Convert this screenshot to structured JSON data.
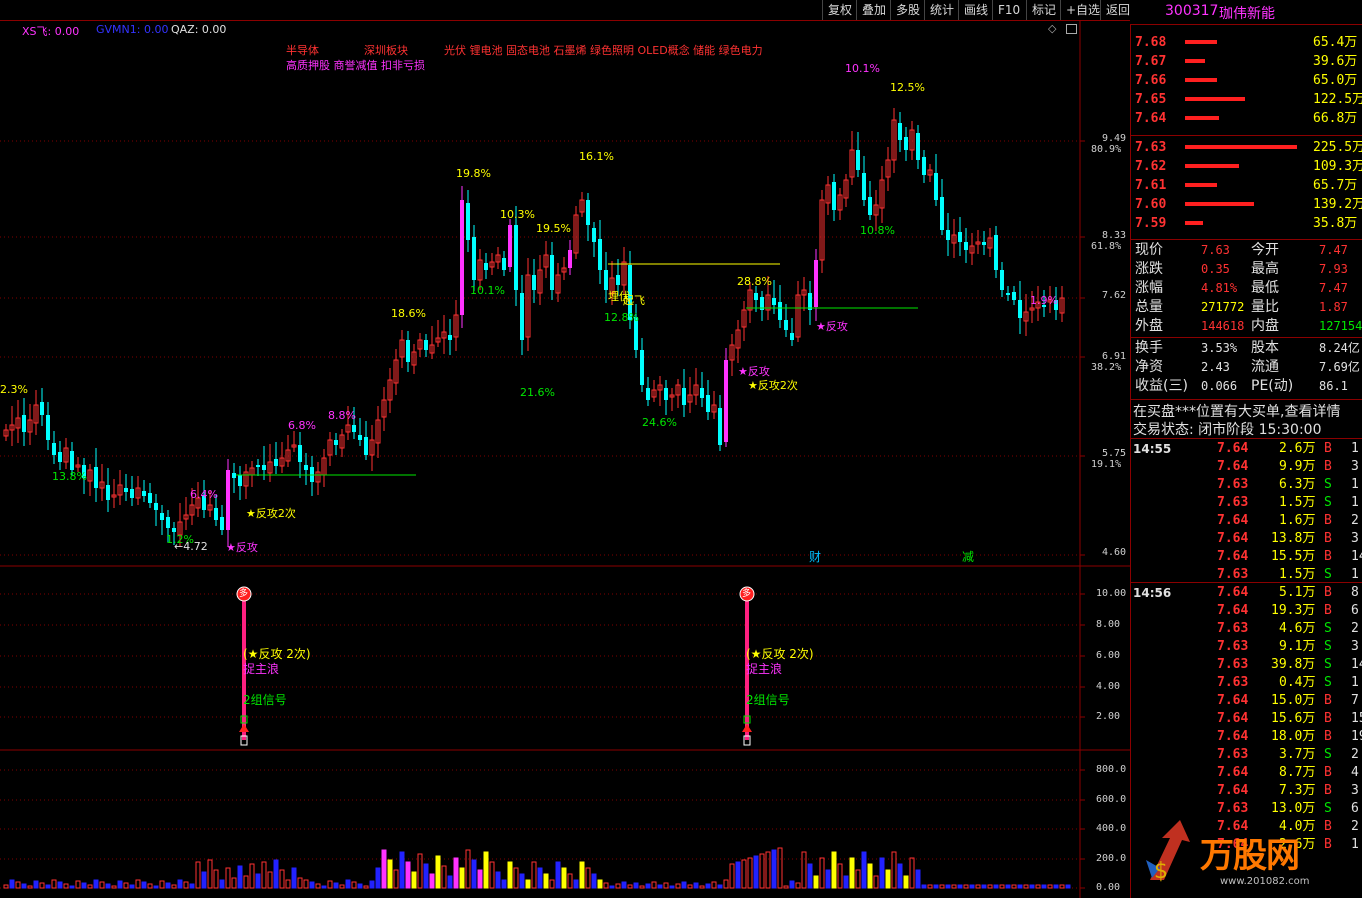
{
  "toolbar": {
    "buttons": [
      "复权",
      "叠加",
      "多股",
      "统计",
      "画线",
      "F10",
      "标记",
      "+自选",
      "返回"
    ]
  },
  "stock": {
    "code": "300317",
    "name": "珈伟新能"
  },
  "indicator_line": {
    "xs_label": "XS飞: 0.00",
    "gvmn_label": "GVMN1: 0.00",
    "qaz_label": "QAZ: 0.00"
  },
  "concepts": {
    "line1_a": "半导体",
    "line1_b": "深圳板块",
    "line1_c": "光伏 锂电池 固态电池 石墨烯 绿色照明 OLED概念 储能 绿色电力",
    "line2": "高质押股 商誉减值 扣非亏损"
  },
  "price_axis": [
    {
      "price": "9.49",
      "pct": "80.9%"
    },
    {
      "price": "8.33",
      "pct": "61.8%"
    },
    {
      "price": "7.62",
      "pct": ""
    },
    {
      "price": "6.91",
      "pct": "38.2%"
    },
    {
      "price": "5.75",
      "pct": "19.1%"
    },
    {
      "price": "4.60",
      "pct": ""
    }
  ],
  "signal_axis": [
    "10.00",
    "8.00",
    "6.00",
    "4.00",
    "2.00"
  ],
  "volume_axis": [
    "800.0",
    "600.0",
    "400.0",
    "200.0",
    "0.00"
  ],
  "chart_labels": [
    {
      "text": "2.3%",
      "color": "#ffff00"
    },
    {
      "text": "13.8%",
      "color": "#00e600"
    },
    {
      "text": "6.4%",
      "color": "#ff33ff"
    },
    {
      "text": "1.2%",
      "color": "#00e600"
    },
    {
      "text": "←4.72",
      "color": "#e0e0e0"
    },
    {
      "text": "★反攻",
      "color": "#ff33ff"
    },
    {
      "text": "★反攻2次",
      "color": "#ffff00"
    },
    {
      "text": "6.8%",
      "color": "#ff33ff"
    },
    {
      "text": "8.8%",
      "color": "#ff33ff"
    },
    {
      "text": "18.6%",
      "color": "#ffff00"
    },
    {
      "text": "19.8%",
      "color": "#ffff00"
    },
    {
      "text": "10.3%",
      "color": "#ffff00"
    },
    {
      "text": "10.1%",
      "color": "#00e600"
    },
    {
      "text": "19.5%",
      "color": "#ffff00"
    },
    {
      "text": "21.6%",
      "color": "#00e600"
    },
    {
      "text": "16.1%",
      "color": "#ffff00"
    },
    {
      "text": "埋伏",
      "color": "#ffff00"
    },
    {
      "text": "起飞",
      "color": "#ffff00"
    },
    {
      "text": "12.8%",
      "color": "#00e600"
    },
    {
      "text": "24.6%",
      "color": "#00e600"
    },
    {
      "text": "28.8%",
      "color": "#ffff00"
    },
    {
      "text": "★反攻",
      "color": "#ff33ff"
    },
    {
      "text": "★反攻2次",
      "color": "#ffff00"
    },
    {
      "text": "★反攻",
      "color": "#ff33ff"
    },
    {
      "text": "10.1%",
      "color": "#ff33ff"
    },
    {
      "text": "12.5%",
      "color": "#ffff00"
    },
    {
      "text": "10.8%",
      "color": "#00e600"
    },
    {
      "text": "1.9%",
      "color": "#ff33ff"
    },
    {
      "text": "财",
      "color": "#00bfff"
    },
    {
      "text": "减",
      "color": "#00e600"
    }
  ],
  "signals": [
    {
      "badge": "多",
      "l1": "(★反攻 2次)",
      "l2": "捉主浪",
      "l3": "2组信号"
    },
    {
      "badge": "多",
      "l1": "(★反攻 2次)",
      "l2": "捉主浪",
      "l3": "2组信号"
    }
  ],
  "order_book": {
    "asks": [
      {
        "price": "7.68",
        "vol": "65.4万",
        "bar": 0.29
      },
      {
        "price": "7.67",
        "vol": "39.6万",
        "bar": 0.18
      },
      {
        "price": "7.66",
        "vol": "65.0万",
        "bar": 0.29
      },
      {
        "price": "7.65",
        "vol": "122.5万",
        "bar": 0.54
      },
      {
        "price": "7.64",
        "vol": "66.8万",
        "bar": 0.3
      }
    ],
    "bids": [
      {
        "price": "7.63",
        "vol": "225.5万",
        "bar": 1.0
      },
      {
        "price": "7.62",
        "vol": "109.3万",
        "bar": 0.48
      },
      {
        "price": "7.61",
        "vol": "65.7万",
        "bar": 0.29
      },
      {
        "price": "7.60",
        "vol": "139.2万",
        "bar": 0.62
      },
      {
        "price": "7.59",
        "vol": "35.8万",
        "bar": 0.16
      }
    ]
  },
  "quote": [
    {
      "l1": "现价",
      "v1": "7.63",
      "c1": "#ff3232",
      "l2": "今开",
      "v2": "7.47",
      "c2": "#ff3232"
    },
    {
      "l1": "涨跌",
      "v1": "0.35",
      "c1": "#ff3232",
      "l2": "最高",
      "v2": "7.93",
      "c2": "#ff3232"
    },
    {
      "l1": "涨幅",
      "v1": "4.81%",
      "c1": "#ff3232",
      "l2": "最低",
      "v2": "7.47",
      "c2": "#ff3232"
    },
    {
      "l1": "总量",
      "v1": "271772",
      "c1": "#ffff00",
      "l2": "量比",
      "v2": "1.87",
      "c2": "#ff3232"
    },
    {
      "l1": "外盘",
      "v1": "144618",
      "c1": "#ff3232",
      "l2": "内盘",
      "v2": "127154",
      "c2": "#00e600"
    }
  ],
  "quote2": [
    {
      "l1": "换手",
      "v1": "3.53%",
      "l2": "股本",
      "v2": "8.24亿"
    },
    {
      "l1": "净资",
      "v1": "2.43",
      "l2": "流通",
      "v2": "7.69亿"
    },
    {
      "l1": "收益(三)",
      "v1": "0.066",
      "l2": "PE(动)",
      "v2": "86.1"
    }
  ],
  "notice": "在买盘***位置有大买单,查看详情",
  "trade_status": "交易状态: 闭市阶段 15:30:00",
  "ticks_group1": {
    "time": "14:55",
    "rows": [
      {
        "p": "7.64",
        "v": "2.6万",
        "t": "B",
        "n": "1"
      },
      {
        "p": "7.64",
        "v": "9.9万",
        "t": "B",
        "n": "3"
      },
      {
        "p": "7.63",
        "v": "6.3万",
        "t": "S",
        "n": "1"
      },
      {
        "p": "7.63",
        "v": "1.5万",
        "t": "S",
        "n": "1"
      },
      {
        "p": "7.64",
        "v": "1.6万",
        "t": "B",
        "n": "2"
      },
      {
        "p": "7.64",
        "v": "13.8万",
        "t": "B",
        "n": "3"
      },
      {
        "p": "7.64",
        "v": "15.5万",
        "t": "B",
        "n": "14"
      },
      {
        "p": "7.63",
        "v": "1.5万",
        "t": "S",
        "n": "1"
      }
    ]
  },
  "ticks_group2": {
    "time": "14:56",
    "rows": [
      {
        "p": "7.64",
        "v": "5.1万",
        "t": "B",
        "n": "8"
      },
      {
        "p": "7.64",
        "v": "19.3万",
        "t": "B",
        "n": "6"
      },
      {
        "p": "7.63",
        "v": "4.6万",
        "t": "S",
        "n": "2"
      },
      {
        "p": "7.63",
        "v": "9.1万",
        "t": "S",
        "n": "3"
      },
      {
        "p": "7.63",
        "v": "39.8万",
        "t": "S",
        "n": "14"
      },
      {
        "p": "7.63",
        "v": "0.4万",
        "t": "S",
        "n": "1"
      },
      {
        "p": "7.64",
        "v": "15.0万",
        "t": "B",
        "n": "7"
      },
      {
        "p": "7.64",
        "v": "15.6万",
        "t": "B",
        "n": "15"
      },
      {
        "p": "7.64",
        "v": "18.0万",
        "t": "B",
        "n": "19"
      },
      {
        "p": "7.63",
        "v": "3.7万",
        "t": "S",
        "n": "2"
      },
      {
        "p": "7.64",
        "v": "8.7万",
        "t": "B",
        "n": "4"
      },
      {
        "p": "7.64",
        "v": "7.3万",
        "t": "B",
        "n": "3"
      },
      {
        "p": "7.63",
        "v": "13.0万",
        "t": "S",
        "n": "6"
      },
      {
        "p": "7.64",
        "v": "4.0万",
        "t": "B",
        "n": "2"
      },
      {
        "p": "7.64",
        "v": "2.6万",
        "t": "B",
        "n": "1"
      }
    ]
  },
  "watermark": {
    "main": "万股网",
    "url": "www.201082.com"
  },
  "colors": {
    "up": "#ff3232",
    "down": "#00ffff",
    "limit_up": "#ff33ff",
    "volume_blue": "#2222ff",
    "volume_yellow": "#ffff00",
    "grid": "#800000"
  }
}
